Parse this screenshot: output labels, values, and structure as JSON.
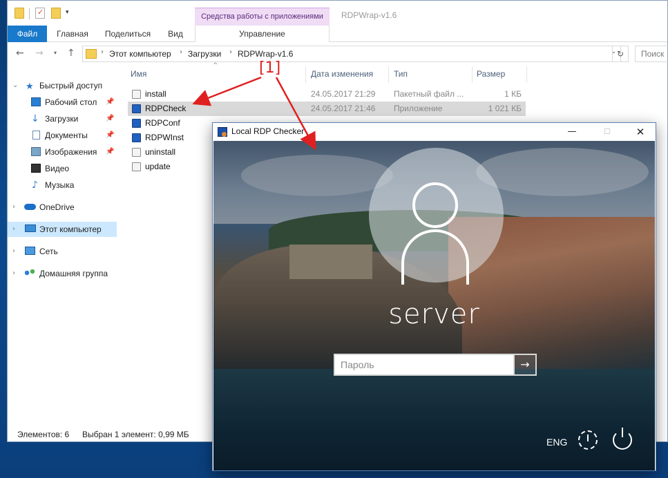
{
  "explorer": {
    "quick_access_arrow": "▾",
    "context_tab": "Средства работы с приложениями",
    "window_title": "RDPWrap-v1.6",
    "tabs": {
      "file": "Файл",
      "home": "Главная",
      "share": "Поделиться",
      "view": "Вид",
      "manage": "Управление"
    },
    "nav": {
      "back": "←",
      "forward": "→",
      "recent": "▾",
      "up": "↑",
      "refresh": "↻"
    },
    "address": {
      "sep": "›",
      "crumbs": [
        "Этот компьютер",
        "Загрузки",
        "RDPWrap-v1.6"
      ],
      "dropdown": "⌄"
    },
    "search_placeholder": "Поиск",
    "sidebar": [
      {
        "label": "Быстрый доступ",
        "icon": "star-icon",
        "chevron": "⌄"
      },
      {
        "label": "Рабочий стол",
        "icon": "desktop-icon",
        "pin": "📌"
      },
      {
        "label": "Загрузки",
        "icon": "download-icon",
        "pin": "📌"
      },
      {
        "label": "Документы",
        "icon": "documents-icon",
        "pin": "📌"
      },
      {
        "label": "Изображения",
        "icon": "pictures-icon",
        "pin": "📌"
      },
      {
        "label": "Видео",
        "icon": "video-icon"
      },
      {
        "label": "Музыка",
        "icon": "music-icon"
      },
      {
        "label": "OneDrive",
        "icon": "onedrive-icon",
        "chevron": "›"
      },
      {
        "label": "Этот компьютер",
        "icon": "computer-icon",
        "chevron": "›"
      },
      {
        "label": "Сеть",
        "icon": "network-icon",
        "chevron": "›"
      },
      {
        "label": "Домашняя группа",
        "icon": "homegroup-icon",
        "chevron": "›"
      }
    ],
    "columns": {
      "name": "Имя",
      "date": "Дата изменения",
      "type": "Тип",
      "size": "Размер",
      "sort_caret": "^"
    },
    "files": [
      {
        "name": "install",
        "date": "24.05.2017 21:29",
        "type": "Пакетный файл ...",
        "size": "1 КБ"
      },
      {
        "name": "RDPCheck",
        "date": "24.05.2017 21:46",
        "type": "Приложение",
        "size": "1 021 КБ"
      },
      {
        "name": "RDPConf",
        "date": "",
        "type": "",
        "size": ""
      },
      {
        "name": "RDPWInst",
        "date": "",
        "type": "",
        "size": ""
      },
      {
        "name": "uninstall",
        "date": "",
        "type": "",
        "size": ""
      },
      {
        "name": "update",
        "date": "",
        "type": "",
        "size": ""
      }
    ],
    "status": {
      "count": "Элементов: 6",
      "selected": "Выбран 1 элемент: 0,99 МБ"
    }
  },
  "annotation": {
    "label": "[1]",
    "color": "#e02020"
  },
  "rdp": {
    "title": "Local RDP Checker",
    "controls": {
      "minimize": "—",
      "maximize": "☐",
      "close": "✕"
    },
    "username": "server",
    "password_placeholder": "Пароль",
    "submit_arrow": "→",
    "language": "ENG"
  }
}
